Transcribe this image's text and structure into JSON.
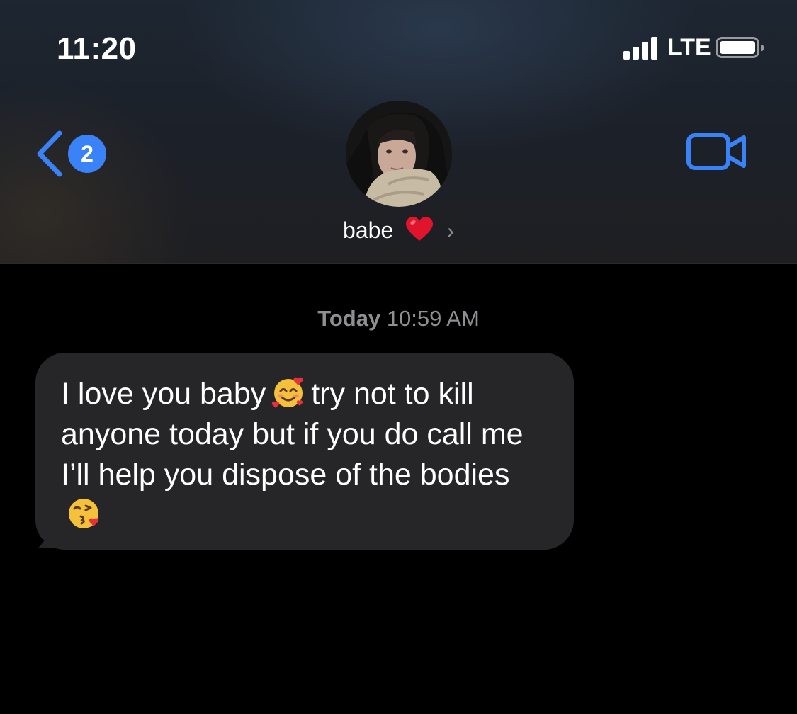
{
  "status_bar": {
    "time": "11:20",
    "network": "LTE",
    "signal_bars": 4,
    "battery_level": 1.0
  },
  "nav": {
    "back_badge_count": "2",
    "back_icon": "chevron-left-icon",
    "video_icon": "video-camera-icon",
    "accent_color": "#3a82f7"
  },
  "contact": {
    "name": "babe",
    "name_emoji": "red-heart",
    "chevron": "›"
  },
  "conversation": {
    "timestamp_day": "Today",
    "timestamp_time": "10:59 AM",
    "messages": [
      {
        "direction": "incoming",
        "parts": [
          "I love you baby",
          "smiling-face-with-hearts",
          "try not to kill anyone today but if you do call me I’ll help you dispose of the bodies",
          "face-blowing-a-kiss"
        ]
      }
    ],
    "bubble_color": "#262629"
  }
}
